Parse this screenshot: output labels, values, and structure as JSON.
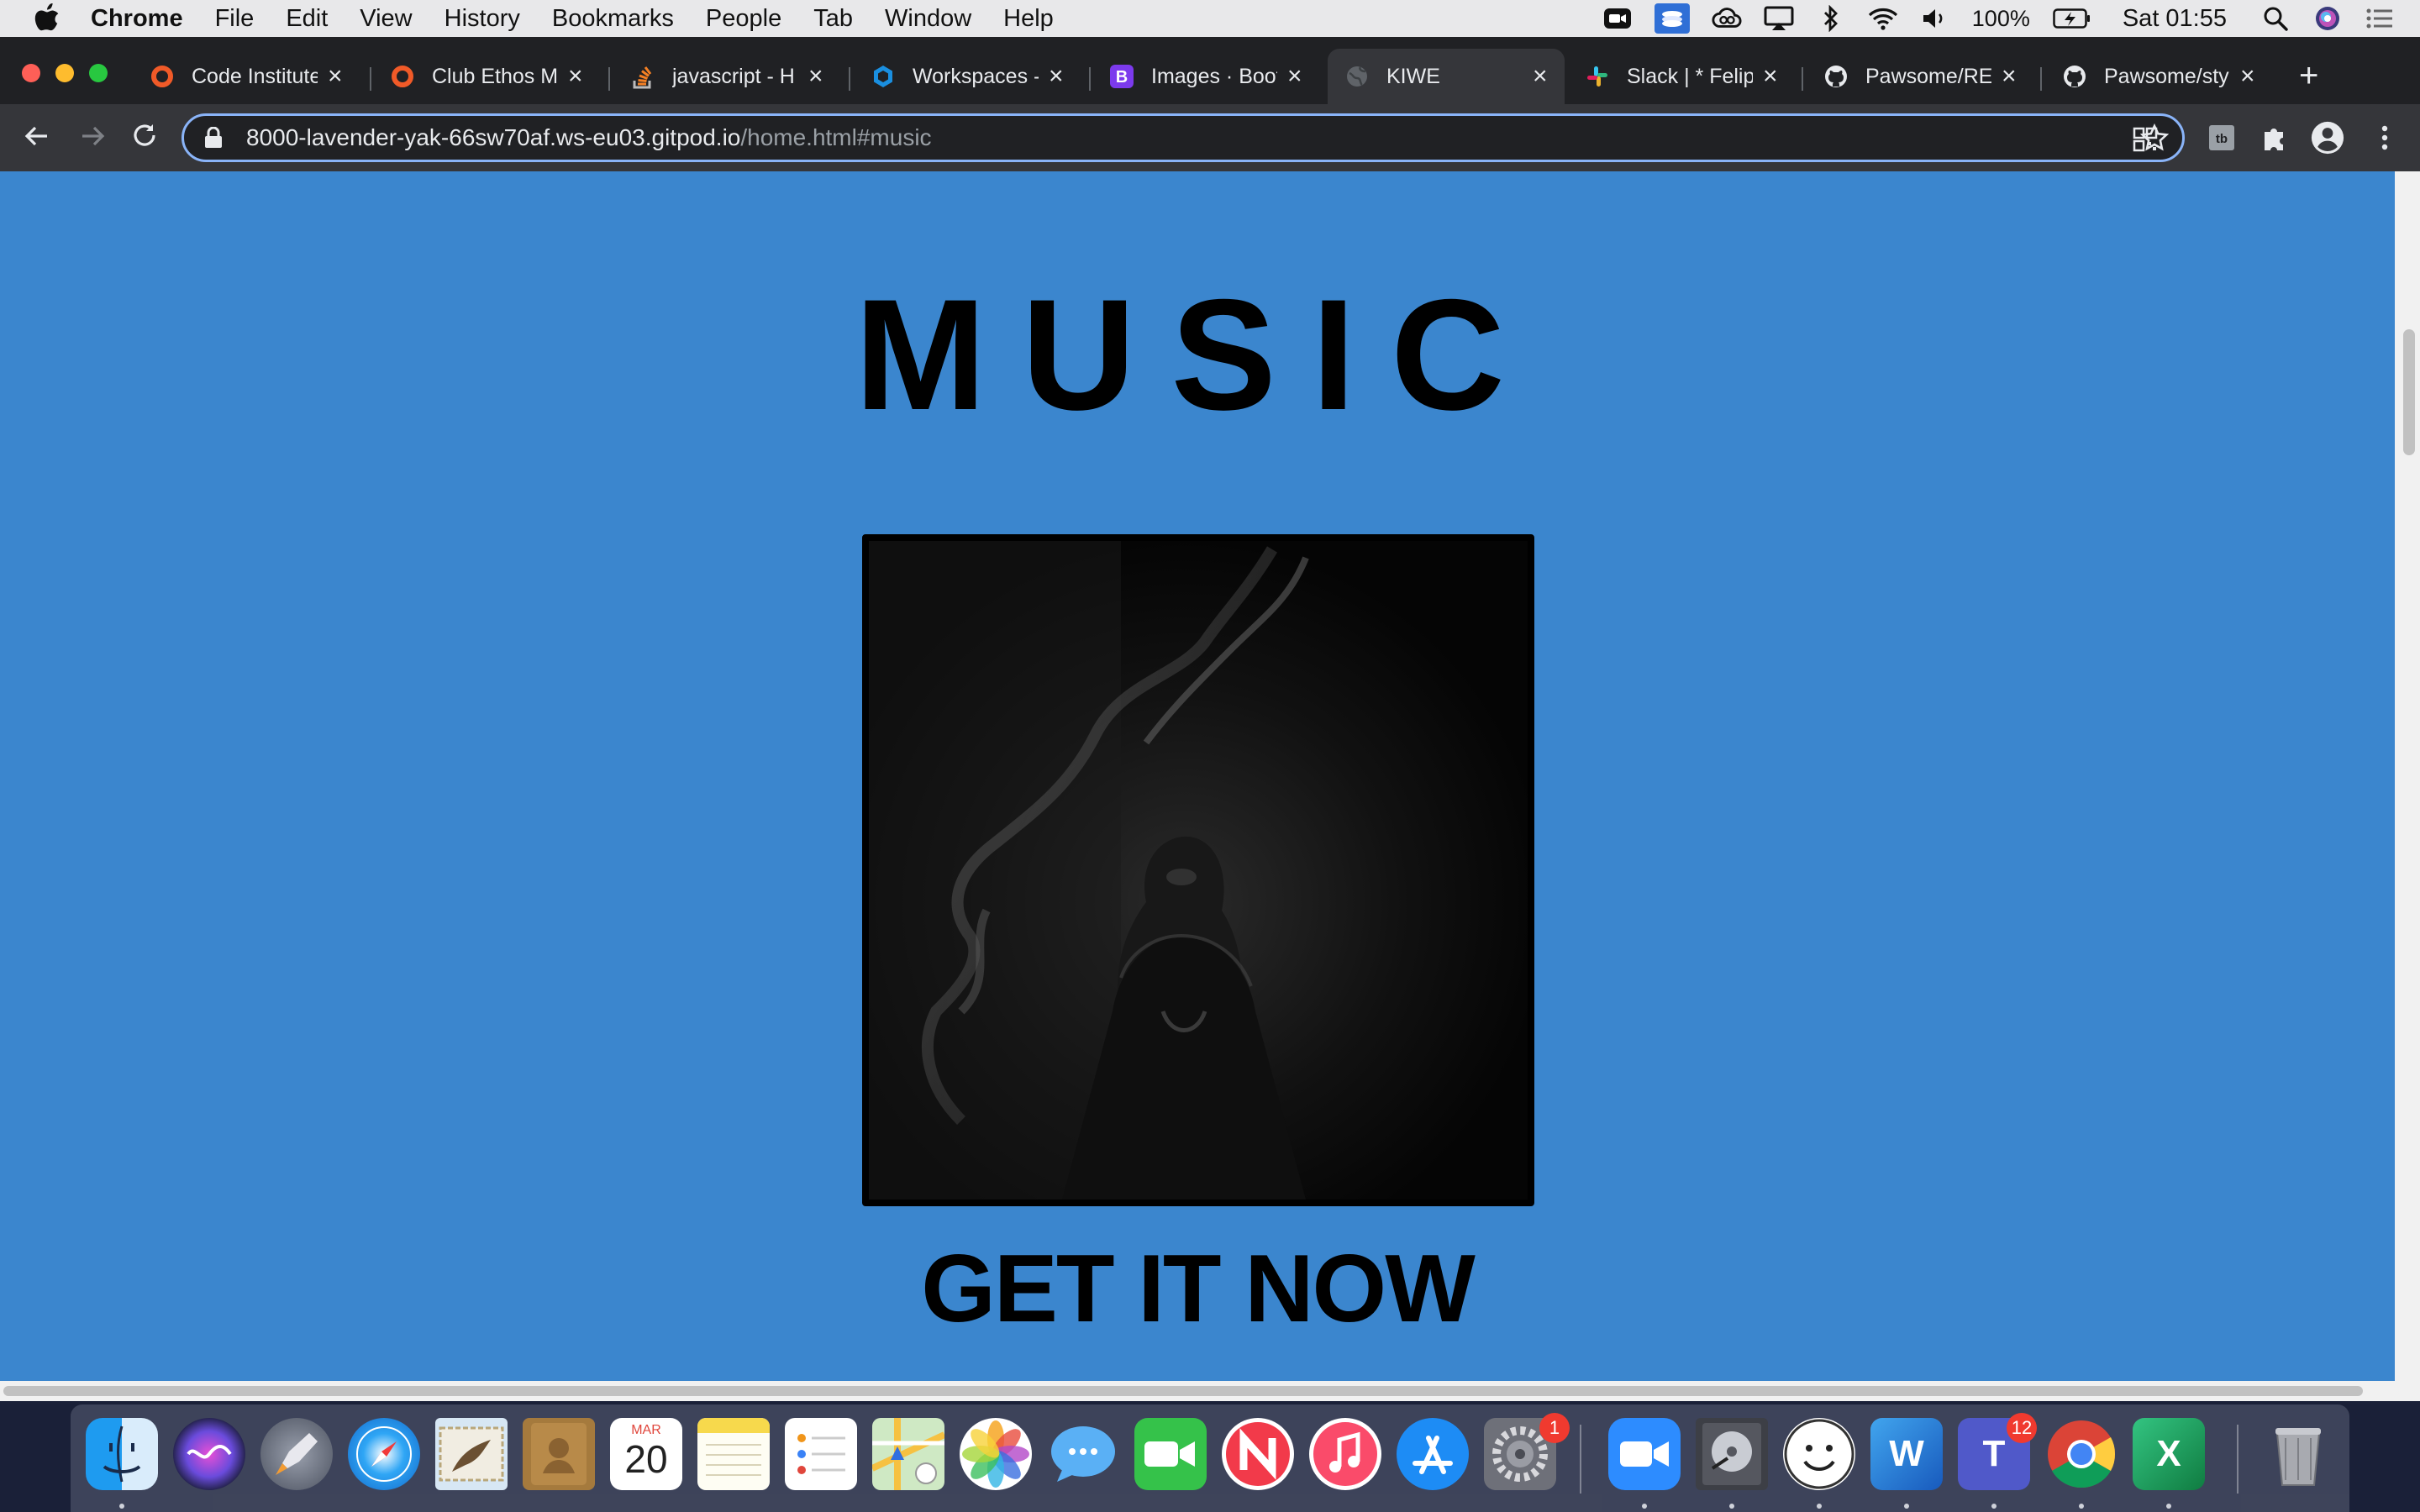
{
  "menubar": {
    "app_name": "Chrome",
    "menus": [
      "File",
      "Edit",
      "View",
      "History",
      "Bookmarks",
      "People",
      "Tab",
      "Window",
      "Help"
    ],
    "battery": "100%",
    "clock": "Sat 01:55"
  },
  "browser": {
    "tabs": [
      {
        "label": "Code Institute",
        "icon": "code-institute-icon",
        "active": false
      },
      {
        "label": "Club Ethos M",
        "icon": "code-institute-icon",
        "active": false
      },
      {
        "label": "javascript - H",
        "icon": "stackoverflow-icon",
        "active": false
      },
      {
        "label": "Workspaces -",
        "icon": "gitpod-icon",
        "active": false
      },
      {
        "label": "Images · Boot",
        "icon": "bootstrap-icon",
        "active": false
      },
      {
        "label": "KIWE",
        "icon": "globe-icon",
        "active": true
      },
      {
        "label": "Slack | * Felip",
        "icon": "slack-icon",
        "active": false
      },
      {
        "label": "Pawsome/RE",
        "icon": "github-icon",
        "active": false
      },
      {
        "label": "Pawsome/sty",
        "icon": "github-icon",
        "active": false
      }
    ],
    "url_host": "8000-lavender-yak-66sw70af.ws-eu03.gitpod.io",
    "url_path": "/home.html#music"
  },
  "page": {
    "section_title": "MUSIC",
    "cta": "GET IT NOW",
    "background_color": "#3b86ce"
  },
  "dock": {
    "apps": [
      {
        "name": "Finder",
        "icon": "finder-icon"
      },
      {
        "name": "Siri",
        "icon": "siri-icon"
      },
      {
        "name": "Launchpad",
        "icon": "launchpad-icon"
      },
      {
        "name": "Safari",
        "icon": "safari-icon"
      },
      {
        "name": "Mail",
        "icon": "mail-icon"
      },
      {
        "name": "Contacts",
        "icon": "contacts-icon"
      },
      {
        "name": "Calendar",
        "icon": "calendar-icon",
        "month": "MAR",
        "day": "20"
      },
      {
        "name": "Notes",
        "icon": "notes-icon"
      },
      {
        "name": "Reminders",
        "icon": "reminders-icon"
      },
      {
        "name": "Maps",
        "icon": "maps-icon"
      },
      {
        "name": "Photos",
        "icon": "photos-icon"
      },
      {
        "name": "Messages",
        "icon": "messages-icon"
      },
      {
        "name": "FaceTime",
        "icon": "facetime-icon"
      },
      {
        "name": "News",
        "icon": "news-icon"
      },
      {
        "name": "Music",
        "icon": "music-icon"
      },
      {
        "name": "App Store",
        "icon": "app-store-icon"
      },
      {
        "name": "System Preferences",
        "icon": "system-preferences-icon",
        "badge": "1"
      },
      {
        "name": "Zoom",
        "icon": "zoom-icon"
      },
      {
        "name": "Disk Utility",
        "icon": "disk-utility-icon"
      },
      {
        "name": "Smiley",
        "icon": "smiley-icon"
      },
      {
        "name": "Word",
        "icon": "word-icon",
        "letter": "W"
      },
      {
        "name": "Teams",
        "icon": "teams-icon",
        "letter": "T",
        "badge": "12"
      },
      {
        "name": "Chrome",
        "icon": "chrome-icon"
      },
      {
        "name": "Excel",
        "icon": "excel-icon",
        "letter": "X"
      },
      {
        "name": "Trash",
        "icon": "trash-icon"
      }
    ]
  }
}
